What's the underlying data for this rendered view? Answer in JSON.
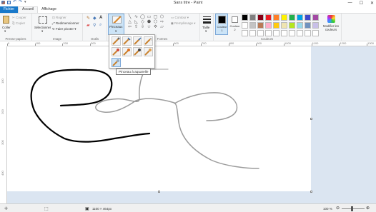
{
  "window": {
    "title": "Sans titre - Paint"
  },
  "tabs": [
    {
      "label": "Fichier"
    },
    {
      "label": "Accueil"
    },
    {
      "label": "Affichage"
    }
  ],
  "ribbon": {
    "clipboard": {
      "paste": "Coller",
      "cut": "Couper",
      "copy": "Copier",
      "group": "Presse-papiers"
    },
    "image": {
      "select": "Sélectionner",
      "crop": "Rogner",
      "resize": "Redimensionner",
      "rotate": "Faire pivoter",
      "group": "Image"
    },
    "tools": {
      "group": "Outils"
    },
    "brushes": {
      "label": "Pinceaux"
    },
    "shapes": {
      "outline": "Contour",
      "fill": "Remplissage",
      "group": "Formes"
    },
    "size": {
      "label": "Taille"
    },
    "colors": {
      "color1": "Couleur 1",
      "color2": "Couleur 2",
      "edit": "Modifier les couleurs",
      "group": "Couleurs",
      "color1_value": "#000000",
      "color2_value": "#ffffff",
      "palette": [
        "#000000",
        "#7f7f7f",
        "#880015",
        "#ed1c24",
        "#ff7f27",
        "#fff200",
        "#22b14c",
        "#00a2e8",
        "#3f48cc",
        "#a349a4",
        "#ffffff",
        "#c3c3c3",
        "#b97a57",
        "#ffaec9",
        "#ffc90e",
        "#efe4b0",
        "#b5e61d",
        "#99d9ea",
        "#7092be",
        "#c8bfe7",
        "#ffffff",
        "#ffffff",
        "#ffffff",
        "#ffffff",
        "#ffffff",
        "#ffffff",
        "#ffffff",
        "#ffffff",
        "#ffffff",
        "#ffffff"
      ]
    }
  },
  "ruler": {
    "top": [
      "0",
      "100",
      "200",
      "300",
      "400",
      "500",
      "600",
      "700",
      "800",
      "900",
      "1000",
      "1100",
      "1200",
      "1300"
    ],
    "left": [
      "100",
      "200",
      "300",
      "400"
    ]
  },
  "brush_dropdown": {
    "tooltip": "Pinceau à aquarelle"
  },
  "status": {
    "dimensions": "1100 × 464px",
    "zoom": "100 %"
  }
}
